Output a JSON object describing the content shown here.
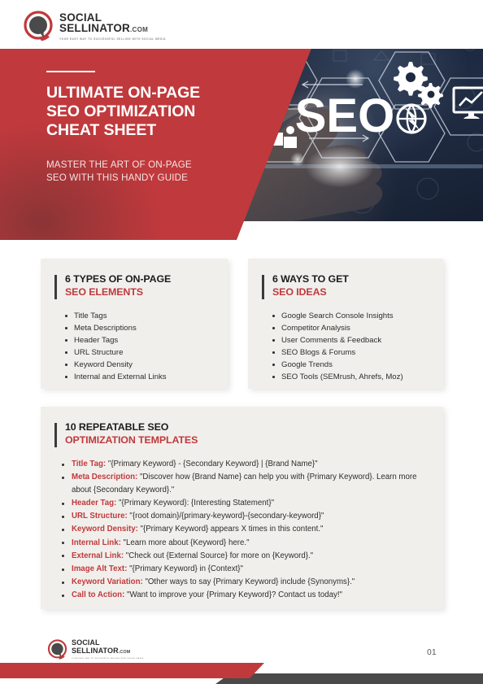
{
  "brand": {
    "logo_icon": "speech-bubble-logo-icon",
    "name_line1": "SOCIAL",
    "name_line2": "SELLINATOR",
    "domain_suffix": ".COM",
    "tagline": "YOUR EASY WAY TO SUCCESSFUL SELLING WITH SOCIAL MEDIA",
    "accent_color": "#C0393C",
    "dark_color": "#4A4A4A"
  },
  "hero": {
    "title_line1": "ULTIMATE ON-PAGE",
    "title_line2": "SEO OPTIMIZATION",
    "title_line3": "CHEAT SHEET",
    "subtitle_line1": "MASTER THE ART OF ON-PAGE",
    "subtitle_line2": "SEO WITH THIS HANDY GUIDE",
    "image_alt": "hand touching hexagonal SEO icons",
    "image_center_text": "SEO",
    "image_icons": [
      "target-icon",
      "people-icon",
      "gears-icon",
      "globe-refresh-icon",
      "chart-monitor-icon"
    ]
  },
  "cards": [
    {
      "head_line1": "6 TYPES OF ON-PAGE",
      "head_line2": "SEO ELEMENTS",
      "items": [
        "Title Tags",
        "Meta Descriptions",
        "Header Tags",
        "URL Structure",
        "Keyword Density",
        "Internal and External Links"
      ]
    },
    {
      "head_line1": "6 WAYS TO GET",
      "head_line2": "SEO IDEAS",
      "items": [
        "Google Search Console Insights",
        "Competitor Analysis",
        "User Comments & Feedback",
        "SEO Blogs & Forums",
        "Google Trends",
        "SEO Tools (SEMrush, Ahrefs, Moz)"
      ]
    }
  ],
  "templates": {
    "head_line1": "10 REPEATABLE SEO",
    "head_line2": "OPTIMIZATION TEMPLATES",
    "items": [
      {
        "label": "Title Tag:",
        "text": "\"{Primary Keyword} - {Secondary Keyword} | {Brand Name}\""
      },
      {
        "label": "Meta Description:",
        "text": "\"Discover how {Brand Name} can help you with {Primary Keyword}. Learn more about {Secondary Keyword}.\""
      },
      {
        "label": "Header Tag:",
        "text": "\"{Primary Keyword}: {Interesting Statement}\""
      },
      {
        "label": "URL Structure:",
        "text": "\"{root domain}/{primary-keyword}-{secondary-keyword}\""
      },
      {
        "label": "Keyword Density:",
        "text": "\"{Primary Keyword} appears X times in this content.\""
      },
      {
        "label": "Internal Link:",
        "text": "\"Learn more about {Keyword} here.\""
      },
      {
        "label": "External Link:",
        "text": "\"Check out {External Source} for more on {Keyword}.\""
      },
      {
        "label": "Image Alt Text:",
        "text": "\"{Primary Keyword} in {Context}\""
      },
      {
        "label": "Keyword Variation:",
        "text": "\"Other ways to say {Primary Keyword} include {Synonyms}.\""
      },
      {
        "label": "Call to Action:",
        "text": "\"Want to improve your {Primary Keyword}? Contact us today!\""
      }
    ]
  },
  "footer": {
    "page_number": "01"
  }
}
